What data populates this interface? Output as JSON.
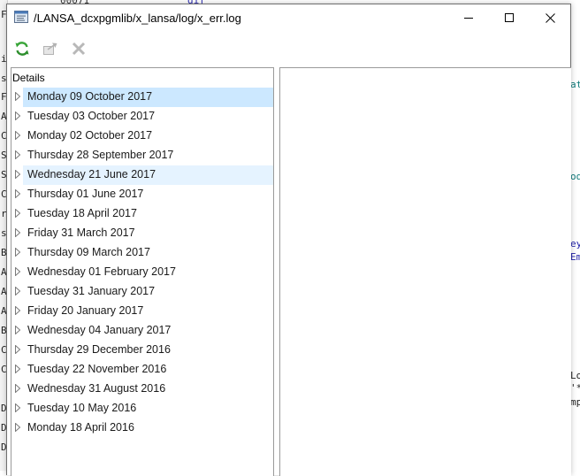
{
  "window": {
    "title": "/LANSA_dcxpgmlib/x_lansa/log/x_err.log"
  },
  "toolbar": {
    "refresh_icon": "refresh-icon",
    "export_icon": "export-icon",
    "delete_icon": "delete-icon"
  },
  "details_panel": {
    "header": "Details",
    "items": [
      {
        "label": "Monday 09 October 2017",
        "state": "selected"
      },
      {
        "label": "Tuesday 03 October 2017",
        "state": ""
      },
      {
        "label": "Monday 02 October 2017",
        "state": ""
      },
      {
        "label": "Thursday 28 September 2017",
        "state": ""
      },
      {
        "label": "Wednesday 21 June 2017",
        "state": "hover"
      },
      {
        "label": "Thursday 01 June 2017",
        "state": ""
      },
      {
        "label": "Tuesday 18 April 2017",
        "state": ""
      },
      {
        "label": "Friday 31 March 2017",
        "state": ""
      },
      {
        "label": "Thursday 09 March 2017",
        "state": ""
      },
      {
        "label": "Wednesday 01 February 2017",
        "state": ""
      },
      {
        "label": "Tuesday 31 January 2017",
        "state": ""
      },
      {
        "label": "Friday 20 January 2017",
        "state": ""
      },
      {
        "label": "Wednesday 04 January 2017",
        "state": ""
      },
      {
        "label": "Thursday 29 December 2016",
        "state": ""
      },
      {
        "label": "Tuesday 22 November 2016",
        "state": ""
      },
      {
        "label": "Wednesday 31 August 2016",
        "state": ""
      },
      {
        "label": "Tuesday 10 May 2016",
        "state": ""
      },
      {
        "label": "Monday 18 April 2016",
        "state": ""
      }
    ]
  },
  "background": {
    "top_fragments": [
      "00071",
      "dif"
    ],
    "left_fragments": [
      "F",
      "i",
      "s",
      "F",
      "A",
      "C",
      "S",
      "S",
      "C",
      "r",
      "s",
      "B",
      "A",
      "A",
      "A",
      "B",
      "C",
      "C",
      "D",
      "D",
      "D"
    ],
    "right_fragments": [
      "at",
      "od",
      "ey",
      "Em",
      "Lo",
      "'*",
      "mp"
    ]
  },
  "colors": {
    "selected_row": "#cce8ff",
    "hover_row": "#e5f3ff",
    "refresh_green": "#3aa53a"
  }
}
